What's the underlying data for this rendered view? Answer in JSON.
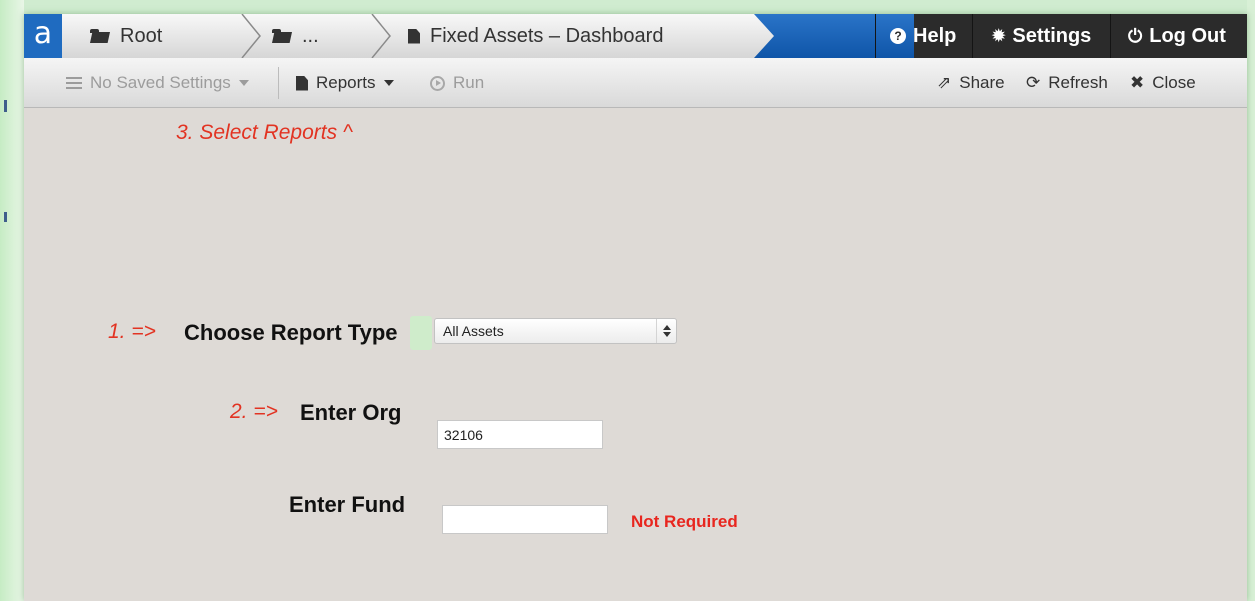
{
  "colors": {
    "accent_blue": "#1f6bc0",
    "topbar_dark": "#2b2b2b",
    "annotation_red": "#e23322",
    "content_bg": "#dedad6"
  },
  "app": {
    "logo_letter": "a"
  },
  "breadcrumbs": [
    {
      "label": "Root",
      "icon": "folder-icon"
    },
    {
      "label": "...",
      "icon": "folder-icon"
    },
    {
      "label": "Fixed Assets – Dashboard",
      "icon": "file-icon"
    }
  ],
  "topnav": {
    "help": {
      "label": "Help",
      "icon": "question-circle-icon"
    },
    "settings": {
      "label": "Settings",
      "icon": "gear-icon"
    },
    "logout": {
      "label": "Log Out",
      "icon": "power-icon"
    }
  },
  "toolbar": {
    "saved_settings": {
      "label": "No Saved Settings",
      "icon": "list-icon",
      "disabled": true
    },
    "reports": {
      "label": "Reports",
      "icon": "file-icon"
    },
    "run": {
      "label": "Run",
      "icon": "play-circle-icon",
      "disabled": true
    },
    "share": {
      "label": "Share",
      "icon": "share-icon"
    },
    "refresh": {
      "label": "Refresh",
      "icon": "refresh-icon"
    },
    "close": {
      "label": "Close",
      "icon": "close-icon"
    }
  },
  "annotations": {
    "step3": "3. Select Reports  ^",
    "step1": "1. =>",
    "step2": "2. =>"
  },
  "form": {
    "report_type": {
      "label": "Choose Report Type",
      "selected": "All Assets"
    },
    "org": {
      "label": "Enter Org",
      "value": "32106"
    },
    "fund": {
      "label": "Enter Fund",
      "value": "",
      "note": "Not Required"
    }
  }
}
